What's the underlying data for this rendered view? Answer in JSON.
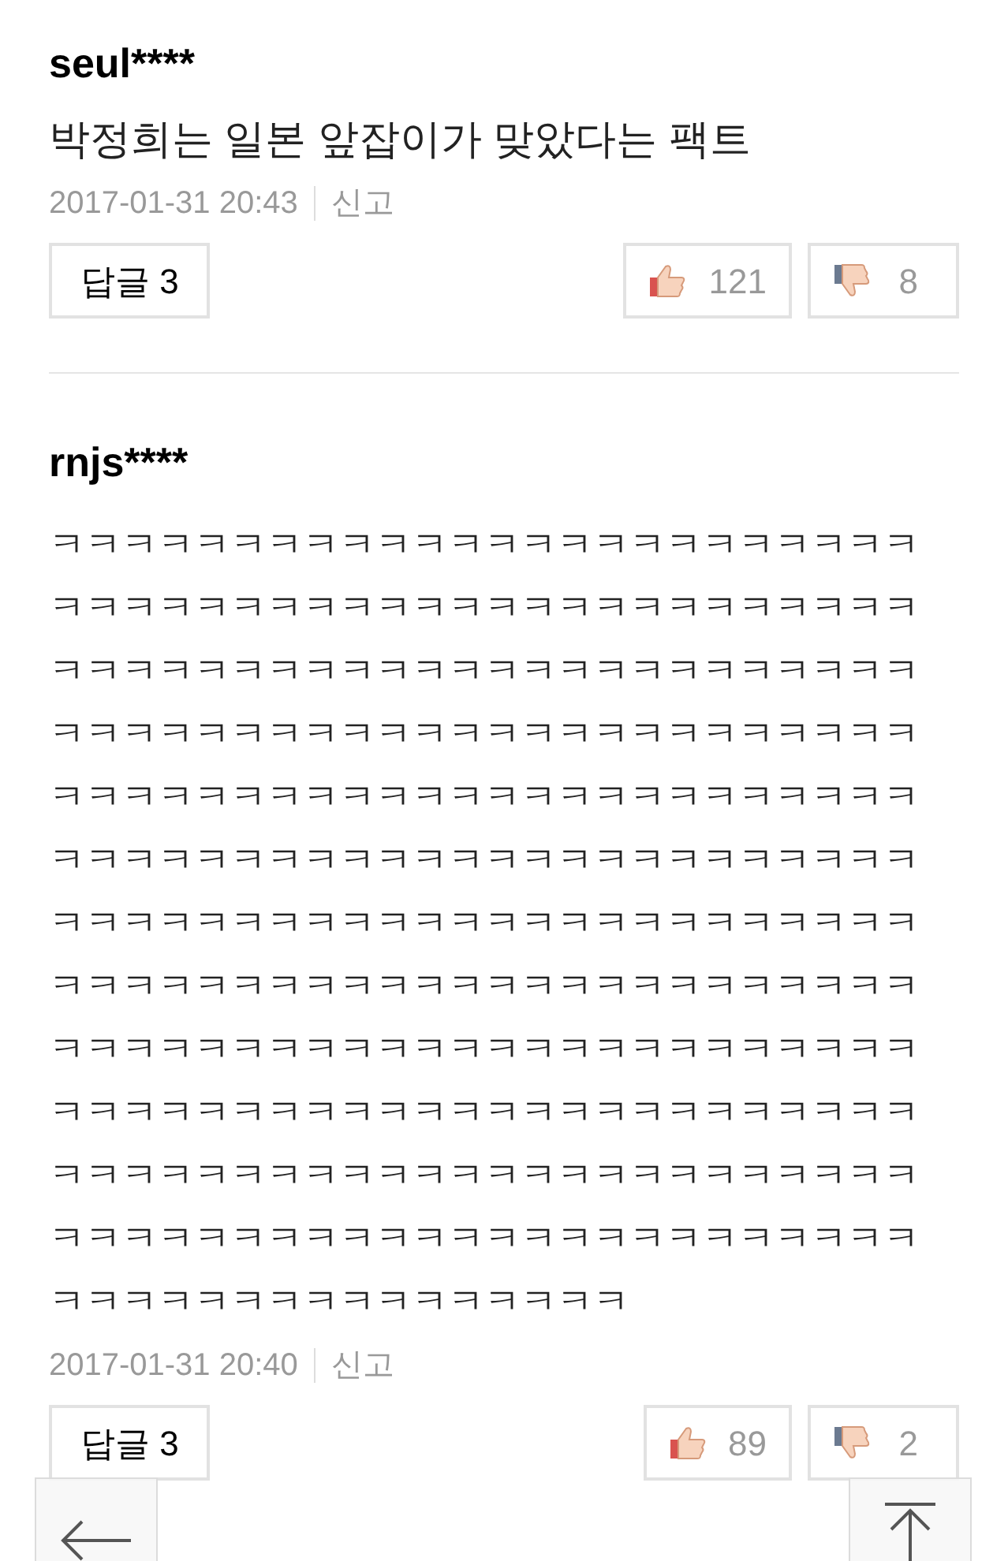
{
  "comments": [
    {
      "author": "seul****",
      "text": "박정희는 일본 앞잡이가 맞았다는 팩트",
      "date": "2017-01-31 20:43",
      "report": "신고",
      "reply_label": "답글",
      "reply_count": "3",
      "likes": "121",
      "dislikes": "8"
    },
    {
      "author": "rnjs****",
      "text": "ㅋㅋㅋㅋㅋㅋㅋㅋㅋㅋㅋㅋㅋㅋㅋㅋㅋㅋㅋㅋㅋㅋㅋㅋㅋㅋㅋㅋㅋㅋㅋㅋㅋㅋㅋㅋㅋㅋㅋㅋㅋㅋㅋㅋㅋㅋㅋㅋㅋㅋㅋㅋㅋㅋㅋㅋㅋㅋㅋㅋㅋㅋㅋㅋㅋㅋㅋㅋㅋㅋㅋㅋㅋㅋㅋㅋㅋㅋㅋㅋㅋㅋㅋㅋㅋㅋㅋㅋㅋㅋㅋㅋㅋㅋㅋㅋㅋㅋㅋㅋㅋㅋㅋㅋㅋㅋㅋㅋㅋㅋㅋㅋㅋㅋㅋㅋㅋㅋㅋㅋㅋㅋㅋㅋㅋㅋㅋㅋㅋㅋㅋㅋㅋㅋㅋㅋㅋㅋㅋㅋㅋㅋㅋㅋㅋㅋㅋㅋㅋㅋㅋㅋㅋㅋㅋㅋㅋㅋㅋㅋㅋㅋㅋㅋㅋㅋㅋㅋㅋㅋㅋㅋㅋㅋㅋㅋㅋㅋㅋㅋㅋㅋㅋㅋㅋㅋㅋㅋㅋㅋㅋㅋㅋㅋㅋㅋㅋㅋㅋㅋㅋㅋㅋㅋㅋㅋㅋㅋㅋㅋㅋㅋㅋㅋㅋㅋㅋㅋㅋㅋㅋㅋㅋㅋㅋㅋㅋㅋㅋㅋㅋㅋㅋㅋㅋㅋㅋㅋㅋㅋㅋㅋㅋㅋㅋㅋㅋㅋㅋㅋㅋㅋㅋㅋㅋㅋㅋㅋㅋㅋㅋㅋㅋㅋㅋㅋㅋㅋㅋㅋㅋㅋㅋㅋㅋㅋㅋㅋㅋㅋㅋㅋㅋㅋㅋㅋㅋㅋㅋㅋㅋㅋㅋㅋㅋㅋㅋㅋㅋㅋㅋㅋㅋㅋ",
      "date": "2017-01-31 20:40",
      "report": "신고",
      "reply_label": "답글",
      "reply_count": "3",
      "likes": "89",
      "dislikes": "2"
    }
  ]
}
